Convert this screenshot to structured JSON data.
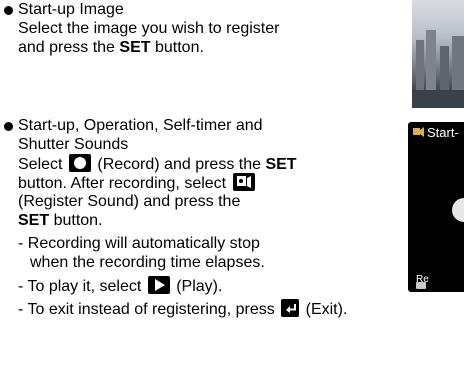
{
  "section1": {
    "title": "Start-up Image",
    "line1": "Select the image you wish to register",
    "line2_prefix": "and press the ",
    "line2_bold": "SET",
    "line2_suffix": " button."
  },
  "section2": {
    "title1": "Start-up, Operation, Self-timer and",
    "title2": "Shutter Sounds",
    "l1_pre": "Select ",
    "l1_mid": " (Record) and press the ",
    "l1_bold": "SET",
    "l2_pre": "button. After recording, select ",
    "l3": "(Register Sound) and press the",
    "l4_bold": "SET",
    "l4_suffix": " button.",
    "d1a": "- Recording will automatically stop",
    "d1b": "when the recording time elapses.",
    "d2_pre": "- To play it, select ",
    "d2_suf": " (Play).",
    "d3_pre": "- To exit instead of registering, press ",
    "d3_suf": " (Exit)."
  },
  "screen": {
    "title": "Start-",
    "bottom_text": "Re"
  },
  "icons": {
    "bullet": "bullet-dot",
    "record": "record-circle-icon",
    "register": "register-sound-icon",
    "play": "play-triangle-icon",
    "exit": "exit-return-icon",
    "mode": "sound-mode-icon"
  }
}
